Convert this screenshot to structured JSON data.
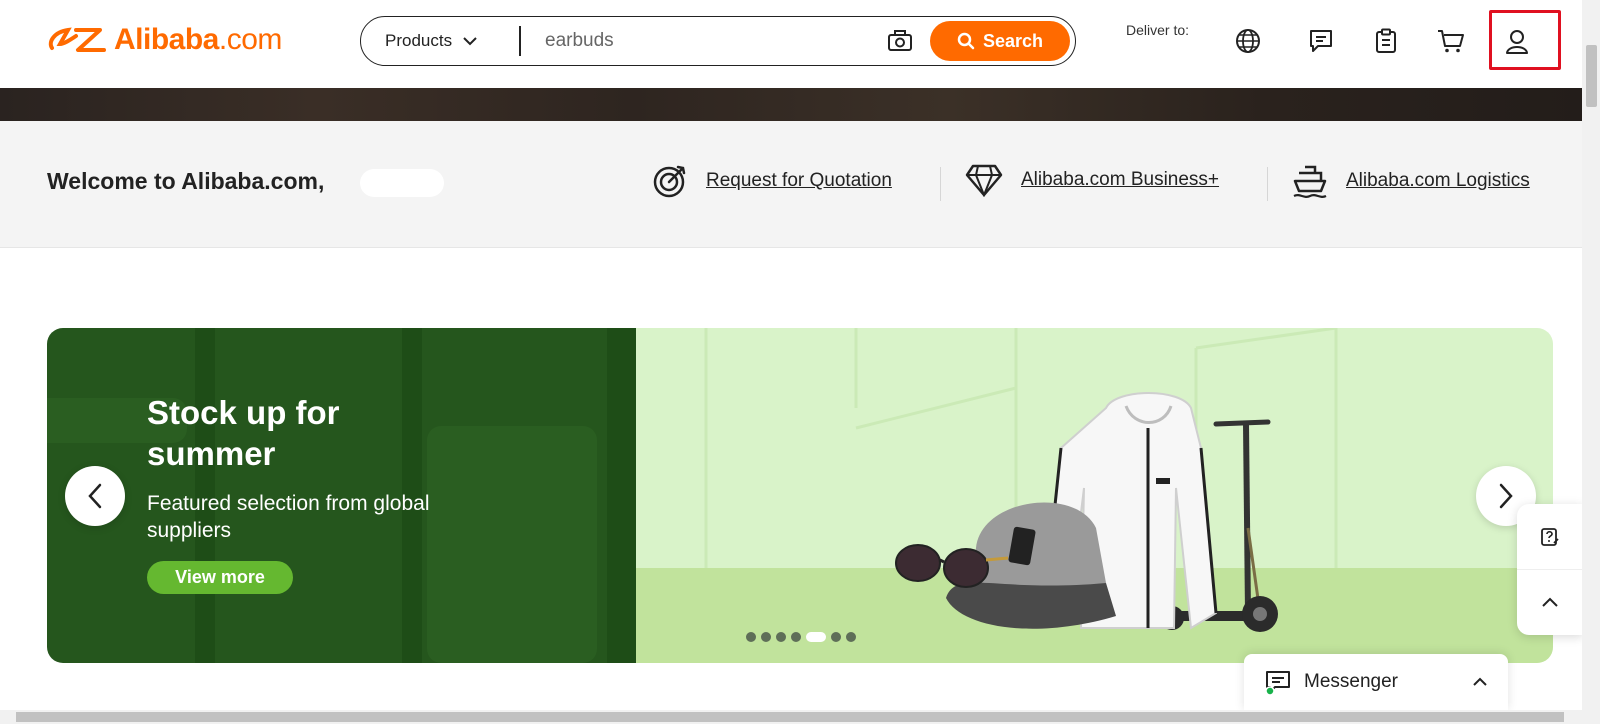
{
  "header": {
    "logo_text": "Alibaba",
    "logo_suffix": ".com",
    "search": {
      "category": "Products",
      "value": "earbuds",
      "button_label": "Search"
    },
    "deliver_to_label": "Deliver to:",
    "icons": [
      "globe-icon",
      "messages-icon",
      "orders-icon",
      "cart-icon",
      "account-icon"
    ]
  },
  "welcome": {
    "greeting": "Welcome to Alibaba.com,",
    "links": [
      {
        "label": "Request for Quotation",
        "icon": "target-icon"
      },
      {
        "label": "Alibaba.com Business+",
        "icon": "diamond-icon"
      },
      {
        "label": "Alibaba.com Logistics",
        "icon": "ship-icon"
      }
    ]
  },
  "banner": {
    "title": "Stock up for summer",
    "subtitle": "Featured selection from global suppliers",
    "cta": "View more",
    "slide_count": 7,
    "active_slide": 5
  },
  "messenger": {
    "label": "Messenger"
  },
  "colors": {
    "brand": "#ff6a00",
    "banner_dark": "#25561d",
    "banner_light": "#d9f3c9",
    "cta": "#65b830",
    "highlight": "#e01020"
  }
}
